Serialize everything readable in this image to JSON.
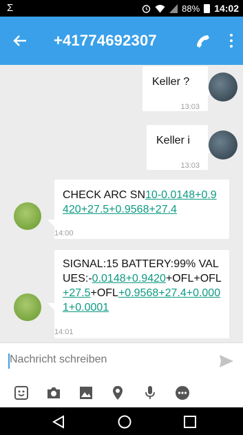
{
  "status_bar": {
    "battery": "88%",
    "time": "14:02",
    "icons": [
      "usb-icon",
      "alarm-icon",
      "wifi-icon",
      "signal-icon",
      "battery-icon"
    ]
  },
  "app_bar": {
    "title": "+41774692307",
    "color": "#3aa0e9",
    "icons": [
      "back-arrow-icon",
      "phone-icon",
      "more-vert-icon"
    ]
  },
  "messages": [
    {
      "direction": "outgoing",
      "text": "Keller ?",
      "time": "13:03"
    },
    {
      "direction": "outgoing",
      "text": "Keller i",
      "time": "13:03"
    },
    {
      "direction": "incoming",
      "parts": [
        {
          "text": "CHECK ARC SN",
          "link": false
        },
        {
          "text": "10-0.0148+0.9420+27.5+0.9568+27.4",
          "link": true
        }
      ],
      "time": "14:00"
    },
    {
      "direction": "incoming",
      "parts": [
        {
          "text": "SIGNAL:15 BATTERY:99% VALUES:-",
          "link": false
        },
        {
          "text": "0.0148+0.9420",
          "link": true
        },
        {
          "text": "+OFL+OFL",
          "link": false
        },
        {
          "text": "+27.5",
          "link": true
        },
        {
          "text": "+OFL",
          "link": false
        },
        {
          "text": "+0.9568+27.4+0.0001+0.0001",
          "link": true
        }
      ],
      "time": "14:01"
    }
  ],
  "compose": {
    "placeholder": "Nachricht schreiben"
  },
  "attach_bar": {
    "icons": [
      "sticker-icon",
      "camera-icon",
      "image-icon",
      "location-icon",
      "microphone-icon",
      "more-horiz-icon"
    ]
  },
  "nav_bar": {
    "icons": [
      "back-nav-icon",
      "home-nav-icon",
      "recents-nav-icon"
    ]
  },
  "colors": {
    "link": "#0e9a83",
    "accent": "#3aa0e9",
    "background": "#ececec"
  }
}
